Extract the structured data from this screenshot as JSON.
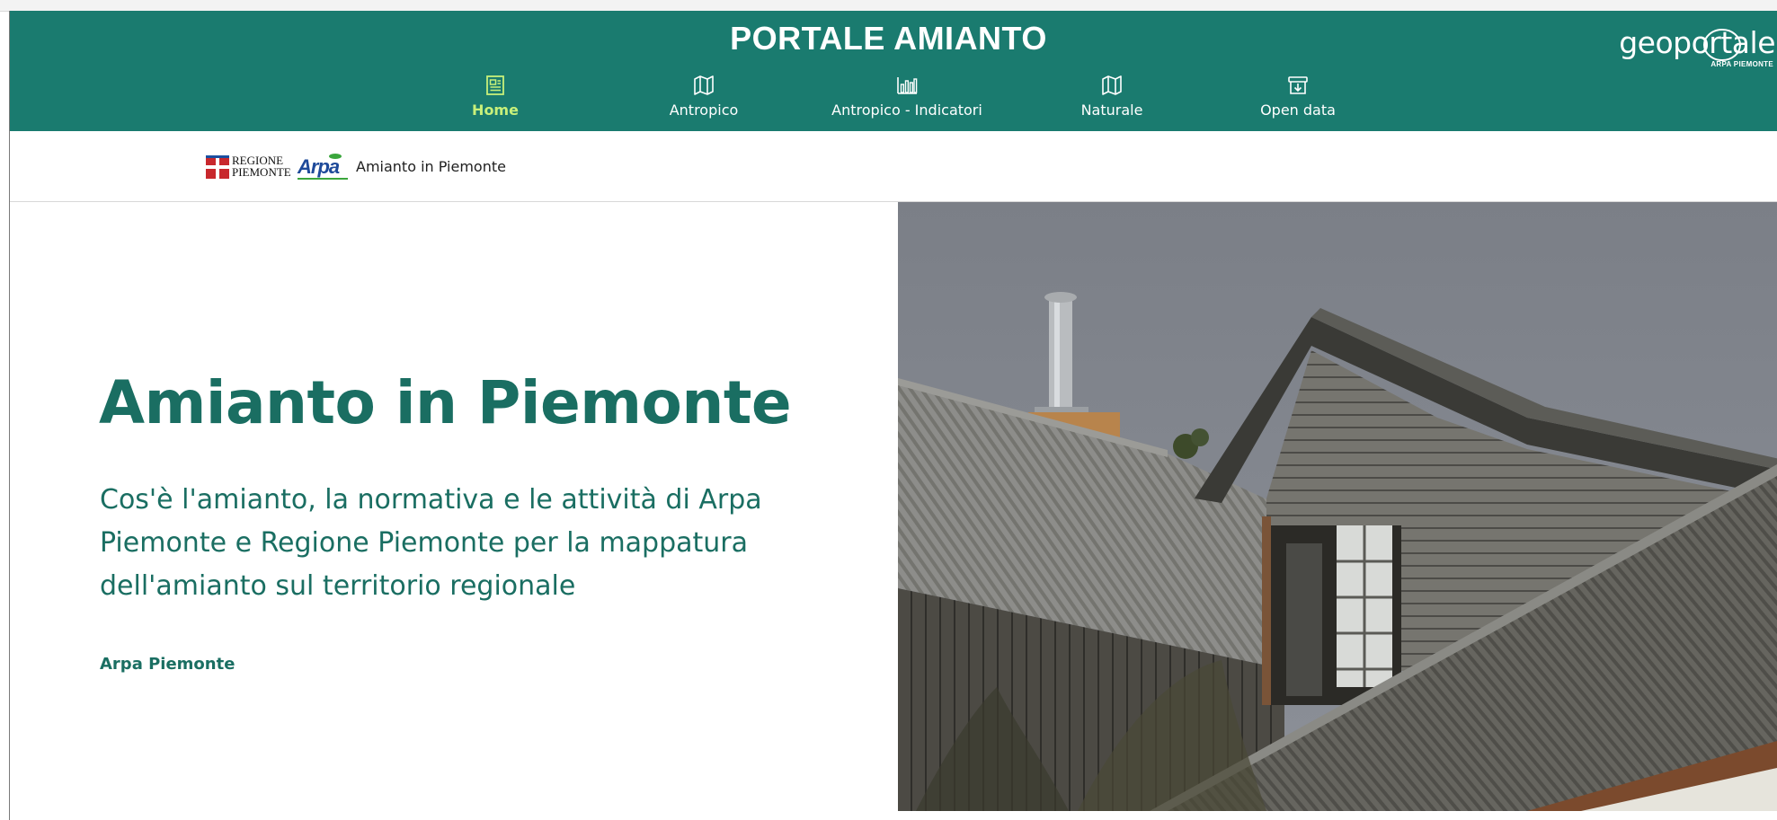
{
  "header": {
    "title": "PORTALE AMIANTO",
    "logo_word": "geoportale",
    "logo_sub": "ARPA PIEMONTE",
    "background_color": "#1a7b6f"
  },
  "nav": {
    "items": [
      {
        "label": "Home",
        "icon": "newspaper-icon",
        "active": true
      },
      {
        "label": "Antropico",
        "icon": "map-icon",
        "active": false
      },
      {
        "label": "Antropico - Indicatori",
        "icon": "bar-chart-icon",
        "active": false
      },
      {
        "label": "Naturale",
        "icon": "map-icon",
        "active": false
      },
      {
        "label": "Open data",
        "icon": "archive-download-icon",
        "active": false
      }
    ],
    "active_color": "#c8f07a"
  },
  "subheader": {
    "logo_regione_line1": "REGIONE",
    "logo_regione_line2": "PIEMONTE",
    "logo_arpa": "Arpa",
    "title": "Amianto in Piemonte"
  },
  "hero": {
    "title": "Amianto in Piemonte",
    "description_lines": [
      "Cos'è l'amianto, la normativa e le attività di Arpa",
      "Piemonte e Regione Piemonte per la mappatura",
      "dell'amianto sul territorio regionale"
    ],
    "author": "Arpa Piemonte",
    "text_color": "#1a6e62",
    "image": "photo of old wooden house with corrugated asbestos roof and chimney"
  }
}
